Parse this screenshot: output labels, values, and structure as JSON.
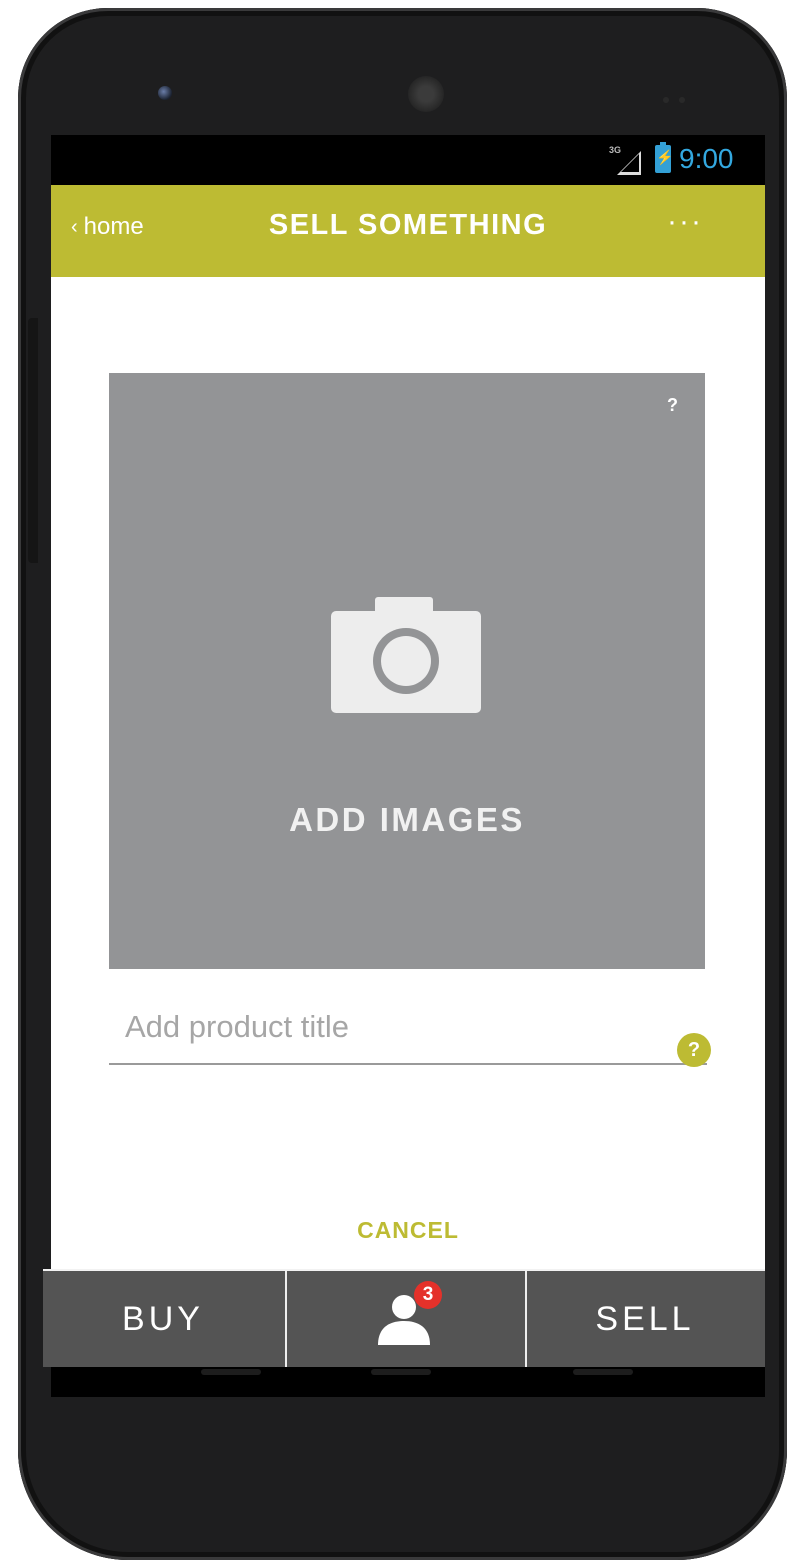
{
  "status_bar": {
    "network": "3G",
    "time": "9:00"
  },
  "app_bar": {
    "back_label": "home",
    "title": "SELL SOMETHING",
    "more_label": "···"
  },
  "image_upload": {
    "help": "?",
    "label": "ADD IMAGES"
  },
  "product_title": {
    "placeholder": "Add product title",
    "value": "",
    "help": "?"
  },
  "cancel_label": "CANCEL",
  "tab_bar": {
    "buy_label": "BUY",
    "profile_badge": "3",
    "sell_label": "SELL"
  },
  "colors": {
    "accent": "#bdbb33",
    "tab_bar": "#545454",
    "badge": "#e4312a",
    "image_placeholder": "#939496"
  }
}
